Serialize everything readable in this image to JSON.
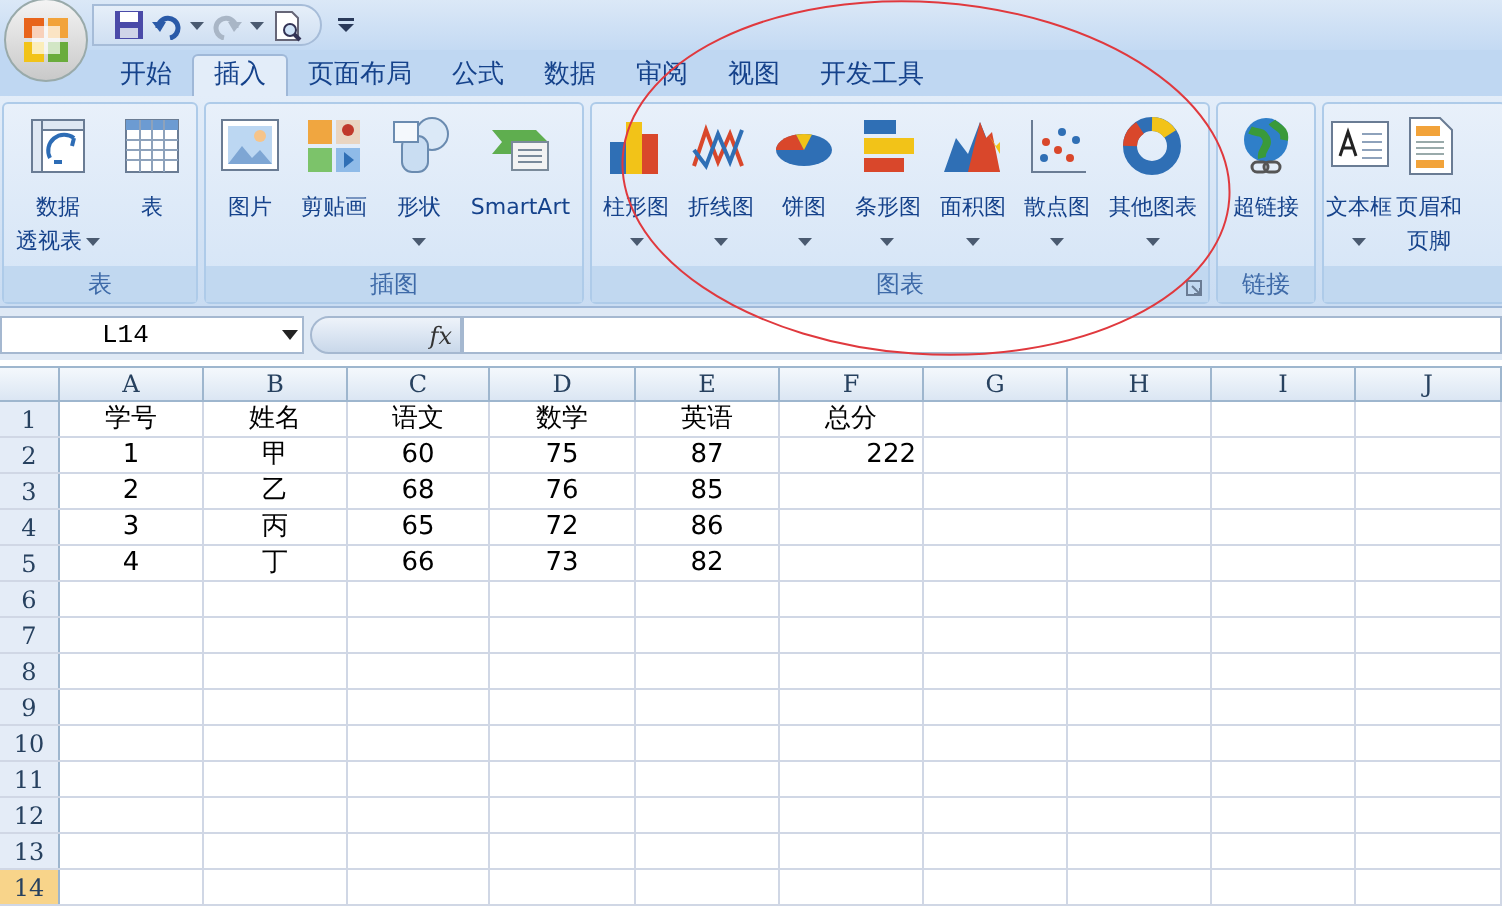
{
  "tabs": [
    {
      "label": "开始",
      "selected": false
    },
    {
      "label": "插入",
      "selected": true
    },
    {
      "label": "页面布局",
      "selected": false
    },
    {
      "label": "公式",
      "selected": false
    },
    {
      "label": "数据",
      "selected": false
    },
    {
      "label": "审阅",
      "selected": false
    },
    {
      "label": "视图",
      "selected": false
    },
    {
      "label": "开发工具",
      "selected": false
    }
  ],
  "ribbon_groups": [
    {
      "label": "表",
      "buttons": [
        {
          "kind": "pivot",
          "label_lines": [
            "数据",
            "透视表"
          ],
          "dropdown": true
        },
        {
          "kind": "table",
          "label_lines": [
            "表"
          ],
          "dropdown": false
        }
      ]
    },
    {
      "label": "插图",
      "buttons": [
        {
          "kind": "picture",
          "label_lines": [
            "图片"
          ],
          "dropdown": false
        },
        {
          "kind": "clipart",
          "label_lines": [
            "剪贴画"
          ],
          "dropdown": false
        },
        {
          "kind": "shapes",
          "label_lines": [
            "形状"
          ],
          "dropdown": true
        },
        {
          "kind": "smartart",
          "label_lines": [
            "SmartArt"
          ],
          "dropdown": false
        }
      ]
    },
    {
      "label": "图表",
      "launcher": true,
      "buttons": [
        {
          "kind": "column",
          "label_lines": [
            "柱形图"
          ],
          "dropdown": true
        },
        {
          "kind": "line",
          "label_lines": [
            "折线图"
          ],
          "dropdown": true
        },
        {
          "kind": "pie",
          "label_lines": [
            "饼图"
          ],
          "dropdown": true
        },
        {
          "kind": "bar",
          "label_lines": [
            "条形图"
          ],
          "dropdown": true
        },
        {
          "kind": "area",
          "label_lines": [
            "面积图"
          ],
          "dropdown": true
        },
        {
          "kind": "scatter",
          "label_lines": [
            "散点图"
          ],
          "dropdown": true
        },
        {
          "kind": "other",
          "label_lines": [
            "其他图表"
          ],
          "dropdown": true
        }
      ]
    },
    {
      "label": "链接",
      "buttons": [
        {
          "kind": "hyperlink",
          "label_lines": [
            "超链接"
          ],
          "dropdown": false
        }
      ]
    },
    {
      "buttons": [
        {
          "kind": "textbox",
          "label_lines": [
            "文本框"
          ],
          "dropdown": true
        },
        {
          "kind": "header",
          "label_lines": [
            "页眉和",
            "页脚"
          ],
          "dropdown": false
        }
      ]
    }
  ],
  "formula_bar": {
    "name_box": "L14",
    "fx": "fx"
  },
  "sheet": {
    "columns": [
      "A",
      "B",
      "C",
      "D",
      "E",
      "F",
      "G",
      "H",
      "I",
      "J"
    ],
    "rows": [
      {
        "header": "1",
        "selected": false,
        "cells": [
          "学号",
          "姓名",
          "语文",
          "数学",
          "英语",
          "总分"
        ]
      },
      {
        "header": "2",
        "selected": false,
        "cells": [
          "1",
          "甲",
          "60",
          "75",
          "87",
          {
            "text": "222",
            "kind": "number"
          }
        ]
      },
      {
        "header": "3",
        "selected": false,
        "cells": [
          "2",
          "乙",
          "68",
          "76",
          "85"
        ]
      },
      {
        "header": "4",
        "selected": false,
        "cells": [
          "3",
          "丙",
          "65",
          "72",
          "86"
        ]
      },
      {
        "header": "5",
        "selected": false,
        "cells": [
          "4",
          "丁",
          "66",
          "73",
          "82"
        ]
      },
      {
        "header": "6",
        "selected": false,
        "cells": []
      },
      {
        "header": "7",
        "selected": false,
        "cells": []
      },
      {
        "header": "8",
        "selected": false,
        "cells": []
      },
      {
        "header": "9",
        "selected": false,
        "cells": []
      },
      {
        "header": "10",
        "selected": false,
        "cells": []
      },
      {
        "header": "11",
        "selected": false,
        "cells": []
      },
      {
        "header": "12",
        "selected": false,
        "cells": []
      },
      {
        "header": "13",
        "selected": false,
        "cells": []
      },
      {
        "header": "14",
        "selected": true,
        "cells": []
      }
    ]
  }
}
